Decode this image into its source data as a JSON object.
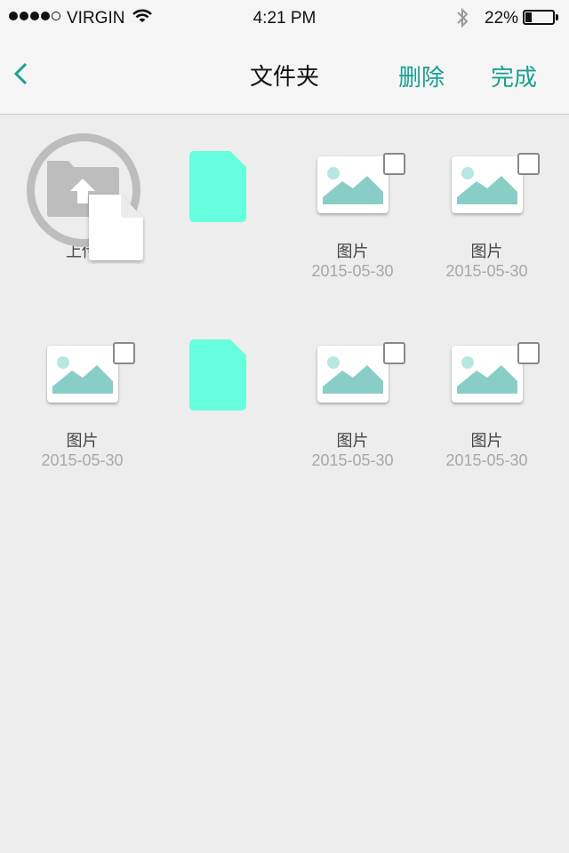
{
  "status_bar": {
    "carrier": "VIRGIN",
    "time": "4:21 PM",
    "battery_percent": "22%",
    "battery_level": 0.22,
    "signal_bars_filled": 4,
    "signal_bars_total": 5
  },
  "nav": {
    "title": "文件夹",
    "delete_label": "删除",
    "done_label": "完成"
  },
  "upload": {
    "label": "上传"
  },
  "files": [
    {
      "type": "image",
      "name": "图片",
      "date": "2015-05-30"
    },
    {
      "type": "image",
      "name": "图片",
      "date": "2015-05-30"
    },
    {
      "type": "image",
      "name": "图片",
      "date": "2015-05-30"
    },
    {
      "type": "image",
      "name": "图片",
      "date": "2015-05-30"
    },
    {
      "type": "image",
      "name": "图片",
      "date": "2015-05-30"
    }
  ],
  "colors": {
    "accent": "#1aa090",
    "document": "#66ffdd",
    "image_glyph": "#88cec6",
    "upload_gray": "#bdbdbd"
  }
}
